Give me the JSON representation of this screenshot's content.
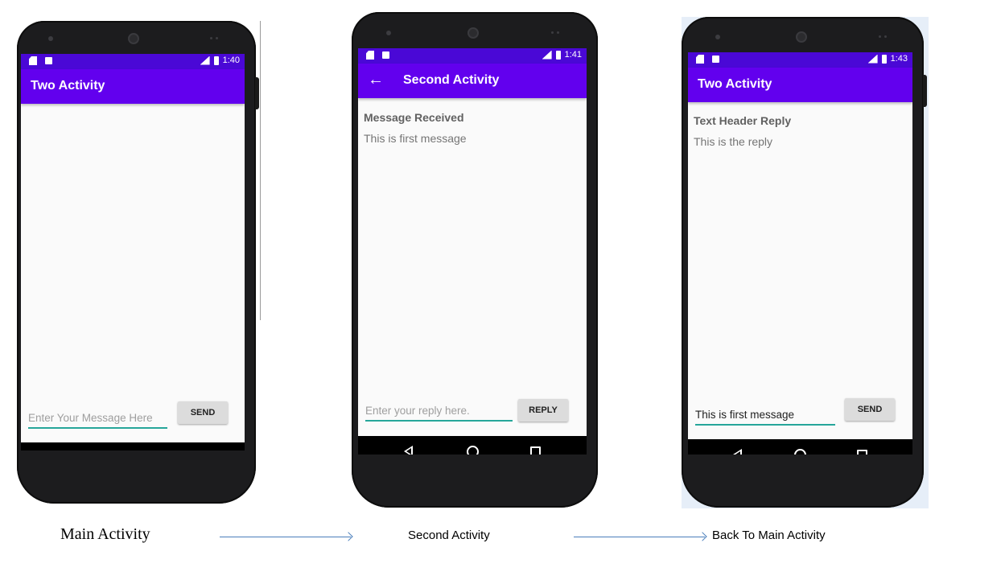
{
  "colors": {
    "app_bar": "#6200ee",
    "status_bar": "#4a08d6",
    "accent_underline": "#26a69a",
    "arrow": "#4a7ebb"
  },
  "status_icons": [
    "sd-card-icon",
    "a-icon",
    "lte-signal-icon",
    "battery-icon"
  ],
  "nav_icons": [
    "back-triangle-icon",
    "home-circle-icon",
    "recents-square-icon"
  ],
  "phones": [
    {
      "time": "1:40",
      "app_title": "Two Activity",
      "input_placeholder": "Enter Your Message Here",
      "button_label": "SEND"
    },
    {
      "time": "1:41",
      "app_title": "Second Activity",
      "header": "Message Received",
      "message": "This is first message",
      "input_placeholder": "Enter your reply here.",
      "button_label": "REPLY"
    },
    {
      "time": "1:43",
      "app_title": "Two Activity",
      "header": "Text Header Reply",
      "message": "This is the reply",
      "input_value": "This is first message",
      "button_label": "SEND"
    }
  ],
  "captions": [
    "Main Activity",
    "Second Activity",
    "Back To Main Activity"
  ]
}
